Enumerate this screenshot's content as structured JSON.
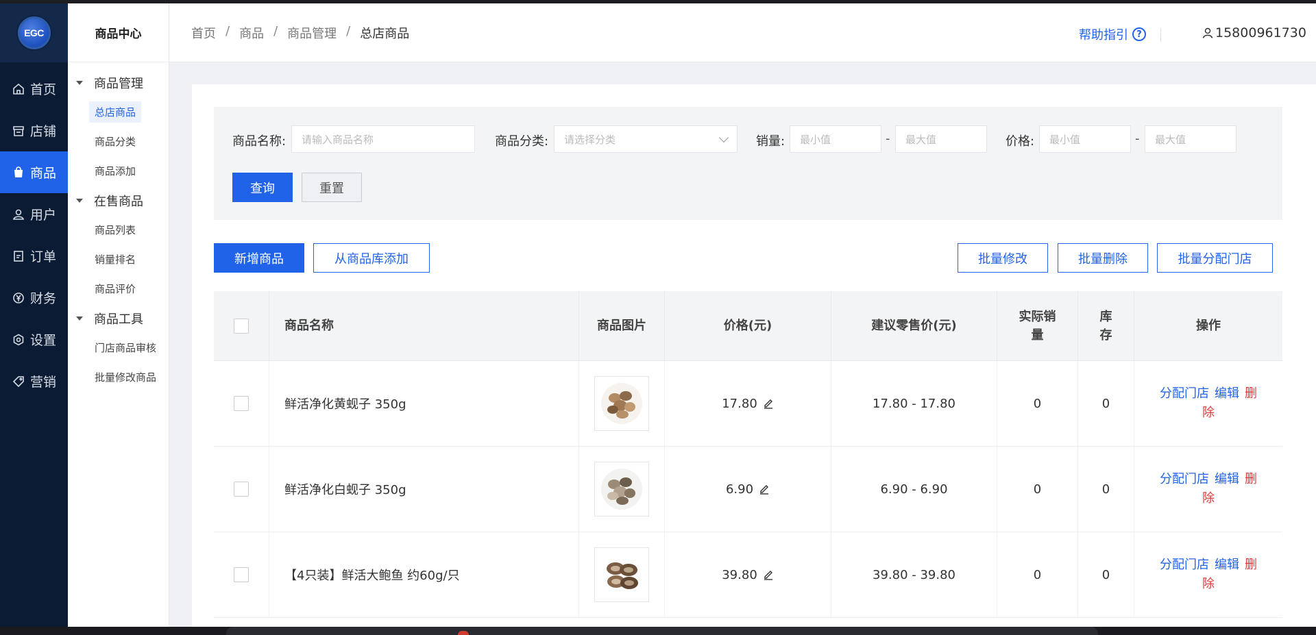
{
  "app": {
    "logo_text": "EGC"
  },
  "rail": {
    "items": [
      {
        "label": "首页",
        "icon": "home-icon"
      },
      {
        "label": "店铺",
        "icon": "store-icon"
      },
      {
        "label": "商品",
        "icon": "bag-icon",
        "active": true
      },
      {
        "label": "用户",
        "icon": "user-icon"
      },
      {
        "label": "订单",
        "icon": "order-icon"
      },
      {
        "label": "财务",
        "icon": "yen-icon"
      },
      {
        "label": "设置",
        "icon": "settings-icon"
      },
      {
        "label": "营销",
        "icon": "tag-icon"
      }
    ]
  },
  "submenu": {
    "title": "商品中心",
    "groups": [
      {
        "label": "商品管理",
        "items": [
          "总店商品",
          "商品分类",
          "商品添加"
        ]
      },
      {
        "label": "在售商品",
        "items": [
          "商品列表",
          "销量排名",
          "商品评价"
        ]
      },
      {
        "label": "商品工具",
        "items": [
          "门店商品审核",
          "批量修改商品"
        ]
      }
    ],
    "active_item": "总店商品"
  },
  "header": {
    "breadcrumb": [
      "首页",
      "商品",
      "商品管理",
      "总店商品"
    ],
    "separator": "/",
    "help_label": "帮助指引",
    "help_icon": "question-circle-icon",
    "user_phone": "15800961730"
  },
  "filter": {
    "name_label": "商品名称:",
    "name_placeholder": "请输入商品名称",
    "category_label": "商品分类:",
    "category_placeholder": "请选择分类",
    "sales_label": "销量:",
    "price_label": "价格:",
    "min_placeholder": "最小值",
    "max_placeholder": "最大值",
    "range_sep": "-",
    "search_button": "查询",
    "reset_button": "重置"
  },
  "actions": {
    "add_product": "新增商品",
    "add_from_library": "从商品库添加",
    "batch_edit": "批量修改",
    "batch_delete": "批量删除",
    "batch_assign": "批量分配门店"
  },
  "table": {
    "columns": [
      "商品名称",
      "商品图片",
      "价格(元)",
      "建议零售价(元)",
      "实际销量",
      "库存",
      "操作"
    ],
    "col_sales_line1": "实际销",
    "col_sales_line2": "量",
    "col_stock_line1": "库",
    "col_stock_line2": "存",
    "rows": [
      {
        "name": "鲜活净化黄蚬子 350g",
        "price": "17.80",
        "suggested": "17.80 - 17.80",
        "sales": "0",
        "stock": "0"
      },
      {
        "name": "鲜活净化白蚬子 350g",
        "price": "6.90",
        "suggested": "6.90 - 6.90",
        "sales": "0",
        "stock": "0"
      },
      {
        "name": "【4只装】鲜活大鲍鱼 约60g/只",
        "price": "39.80",
        "suggested": "39.80 - 39.80",
        "sales": "0",
        "stock": "0"
      }
    ],
    "op_assign": "分配门店",
    "op_edit": "编辑",
    "op_delete_1": "删",
    "op_delete_2": "除"
  },
  "colors": {
    "primary": "#2163e8",
    "danger": "#e23b3b",
    "rail_bg": "#0b1b33"
  }
}
